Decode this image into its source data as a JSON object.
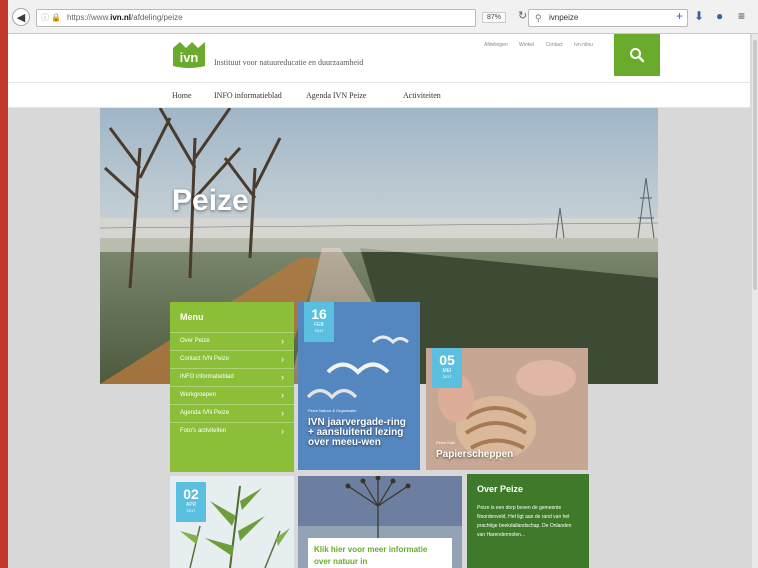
{
  "browser": {
    "url_prefix": "https://www.",
    "url_domain": "ivn.nl",
    "url_path": "/afdeling/peize",
    "zoom": "87%",
    "search_query": "ivnpeize"
  },
  "site": {
    "logo_text": "ivn",
    "tagline": "Instituut voor natuureducatie en duurzaamheid",
    "toplinks": [
      "Afdelingen",
      "Winkel",
      "Contact",
      "Ivn.nl/nu"
    ]
  },
  "nav": {
    "items": [
      "Home",
      "INFO informatieblad",
      "Agenda IVN Peize",
      "Activiteiten"
    ]
  },
  "hero": {
    "title": "Peize"
  },
  "menu": {
    "title": "Menu",
    "items": [
      "Over Peize",
      "Contact IVN Peize",
      "INFO informatieblad",
      "Werkgroepen",
      "Agenda IVN Peize",
      "Foto's activiteiten"
    ]
  },
  "tiles": {
    "tile1": {
      "day": "16",
      "month": "FEB",
      "year": "2017",
      "tags": "Peize   Natuur & Organisatie",
      "title": "IVN jaarvergade-ring + aansluitend lezing over meeu-wen"
    },
    "tile2": {
      "day": "05",
      "month": "MEI",
      "year": "2017",
      "tags": "Peize   Kids",
      "title": "Papierscheppen"
    },
    "tile3": {
      "day": "02",
      "month": "APR",
      "year": "2017"
    },
    "promo": "Klik hier voor meer informatie over natuur in"
  },
  "over": {
    "title": "Over Peize",
    "text": "Peize is een dorp boven de gemeente Noordenveld. Het ligt aan de rand van het prachtige beekdallandschap. De Onlanden van Harendermolen..."
  },
  "colors": {
    "accent_green": "#6aab2e",
    "menu_green": "#8cbf38",
    "dark_green": "#3f7a2a",
    "date_blue": "#5bc0e0"
  }
}
